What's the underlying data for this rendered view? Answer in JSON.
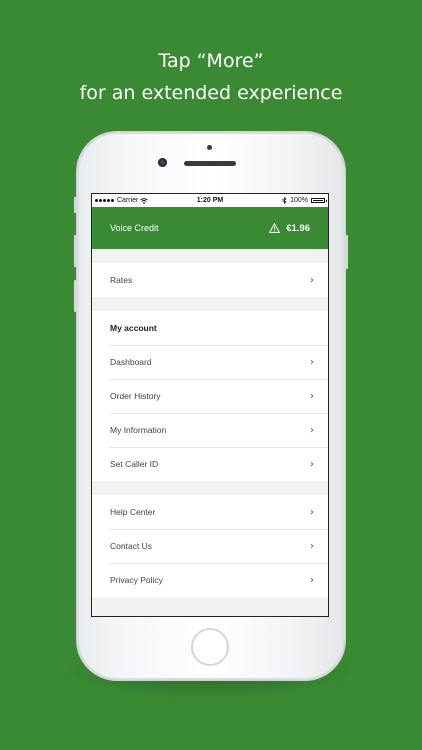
{
  "headline": {
    "line1": "Tap “More”",
    "line2": "for an extended experience"
  },
  "statusbar": {
    "carrier": "Carrier",
    "time": "1:20 PM",
    "battery": "100%"
  },
  "credit": {
    "label": "Voice Credit",
    "amount": "€1.96"
  },
  "menu": {
    "rates": "Rates",
    "account_header": "My account",
    "dashboard": "Dashboard",
    "order_history": "Order History",
    "my_information": "My Information",
    "set_caller_id": "Set Caller ID",
    "help_center": "Help Center",
    "contact_us": "Contact Us",
    "privacy_policy": "Privacy Policy"
  },
  "colors": {
    "brand": "#3a8a34"
  }
}
